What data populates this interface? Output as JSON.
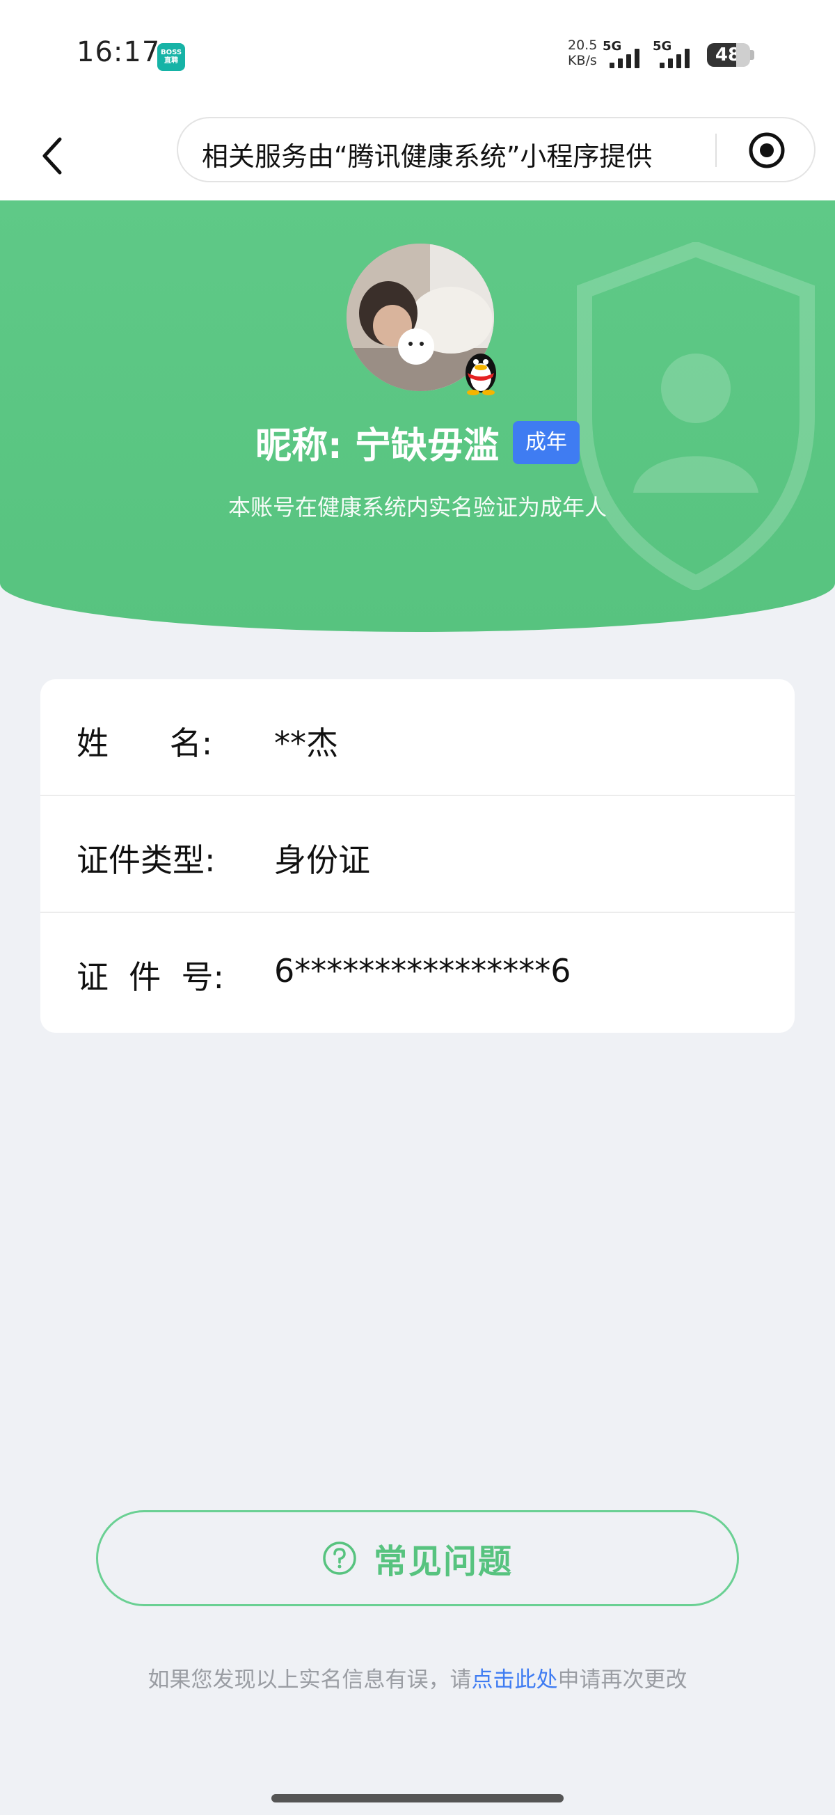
{
  "status_bar": {
    "time": "16:17",
    "app_badge_top": "BOSS",
    "app_badge_bottom": "直聘",
    "net_speed_value": "20.5",
    "net_speed_unit": "KB/s",
    "signal_1_tag": "5G",
    "signal_2_tag": "5G",
    "battery": "48"
  },
  "nav": {
    "service_notice": "相关服务由“腾讯健康系统”小程序提供"
  },
  "profile": {
    "nickname": "昵称: 宁缺毋滥",
    "badge": "成年",
    "verify_note": "本账号在健康系统内实名验证为成年人"
  },
  "info": {
    "rows": [
      {
        "label": "姓      名:",
        "value": "**杰"
      },
      {
        "label": "证件类型:",
        "value": "身份证"
      },
      {
        "label": "证  件  号:",
        "value": "6****************6"
      }
    ]
  },
  "faq": {
    "label": "常见问题"
  },
  "footer": {
    "prefix": "如果您发现以上实名信息有误，请",
    "link": "点击此处",
    "suffix": "申请再次更改"
  },
  "colors": {
    "brand_green": "#57c37f",
    "badge_blue": "#3f7cf2",
    "page_bg": "#eff1f5"
  }
}
